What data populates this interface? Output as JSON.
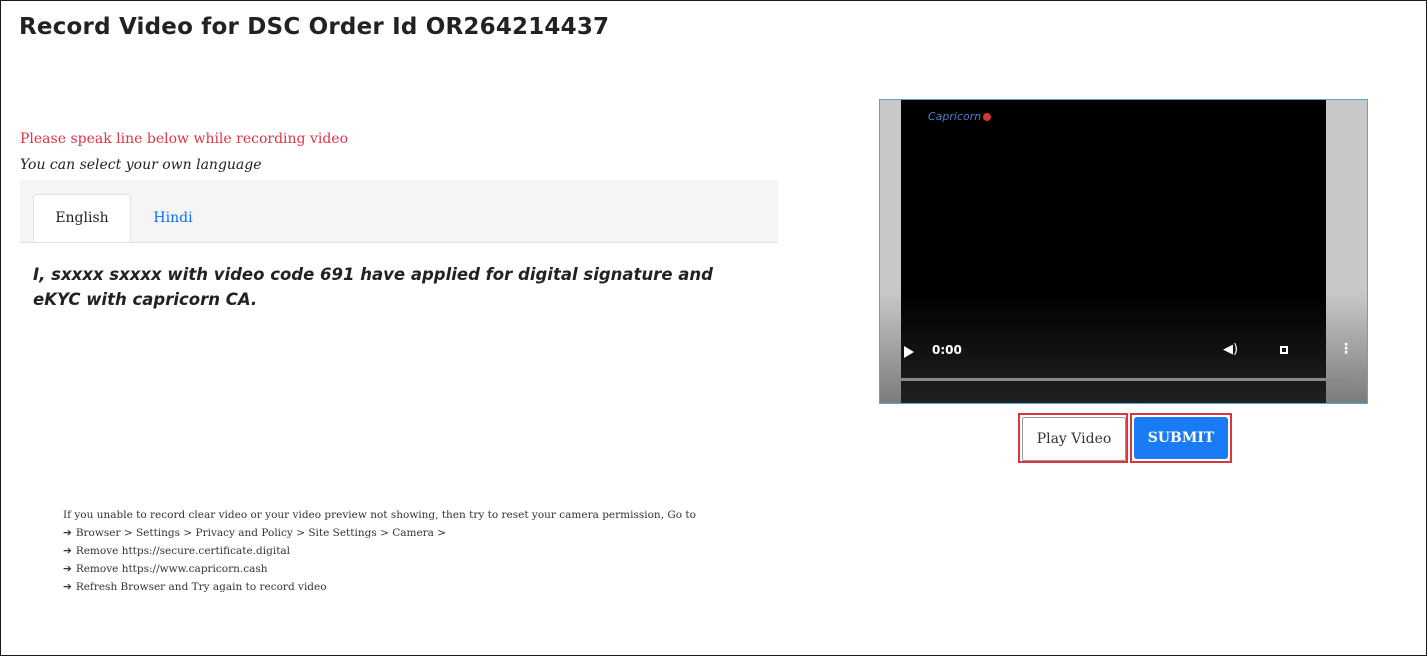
{
  "header": {
    "title": "Record Video for DSC Order Id OR264214437"
  },
  "instructions": {
    "speak_line": "Please speak line below while recording video",
    "language_hint": "You can select your own language"
  },
  "tabs": [
    {
      "label": "English",
      "active": true
    },
    {
      "label": "Hindi",
      "active": false
    }
  ],
  "speech_text": "I, sxxxx  sxxxx  with video code 691 have applied for digital signature and eKYC with capricorn CA.",
  "help": {
    "intro": "If you unable to record clear video or your video preview not showing, then try to reset your camera permission, Go to",
    "arrow_icon": "arrow-right-icon",
    "steps": [
      "Browser > Settings > Privacy and Policy > Site Settings > Camera >",
      "Remove https://secure.certificate.digital",
      "Remove https://www.capricorn.cash",
      "Refresh Browser and Try again to record video"
    ]
  },
  "video": {
    "logo_text": "Capricorn",
    "current_time": "0:00",
    "progress": 0,
    "icons": [
      "play-icon",
      "volume-icon",
      "fullscreen-icon",
      "more-options-icon"
    ]
  },
  "actions": {
    "play_video_label": "Play Video",
    "submit_label": "SUBMIT"
  },
  "colors": {
    "accent": "#1a7cf5",
    "instruction_text": "#dc3545",
    "highlight_border": "#d9363e",
    "link": "#0d6efd"
  }
}
